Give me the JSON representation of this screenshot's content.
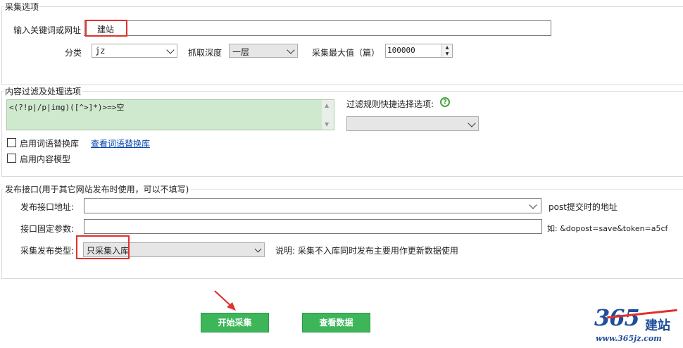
{
  "colors": {
    "accent_green": "#3db65a",
    "highlight_red": "#e0322f",
    "textarea_bg": "#cfe9cf",
    "help_green": "#44a33c"
  },
  "collect": {
    "legend": "采集选项",
    "keyword_label": "输入关键词或网址",
    "keyword_value": "建站",
    "category_label": "分类",
    "category_value": "jz",
    "depth_label": "抓取深度",
    "depth_value": "一层",
    "max_label": "采集最大值（篇）",
    "max_value": "100000"
  },
  "filter": {
    "legend": "内容过滤及处理选项",
    "rule_text": "<(?!p|/p|img)([^>]*)>=>空",
    "quick_label": "过滤规则快捷选择选项:",
    "help_icon": "question-circle-icon",
    "quick_value": "",
    "replace_lib_label": "启用词语替换库",
    "view_lib_link": "查看词语替换库",
    "content_model_label": "启用内容模型"
  },
  "publish": {
    "legend": "发布接口(用于其它网站发布时使用，可以不填写)",
    "url_label": "发布接口地址:",
    "url_value": "",
    "url_hint": "post提交时的地址",
    "params_label": "接口固定参数:",
    "params_value": "",
    "params_hint": "如: &dopost=save&token=a5cf",
    "type_label": "采集发布类型:",
    "type_value": "只采集入库",
    "type_hint": "说明: 采集不入库同时发布主要用作更新数据使用"
  },
  "actions": {
    "start_label": "开始采集",
    "view_label": "查看数据"
  },
  "logo": {
    "number": "365",
    "text": "建站",
    "url": "www.365jz.com"
  }
}
